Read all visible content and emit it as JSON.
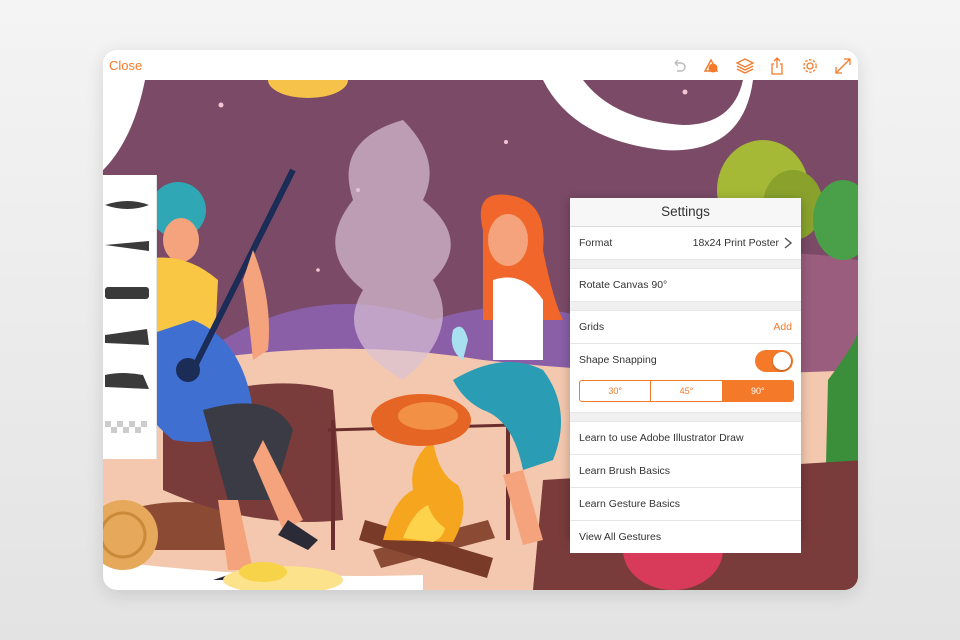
{
  "toolbar": {
    "close_label": "Close",
    "icons": [
      "undo-icon",
      "shapes-icon",
      "layers-icon",
      "share-icon",
      "gear-icon",
      "expand-icon"
    ],
    "accent_color": "#f47a2a"
  },
  "settings": {
    "title": "Settings",
    "format_label": "Format",
    "format_value": "18x24 Print Poster",
    "rotate_label": "Rotate Canvas 90°",
    "grids_label": "Grids",
    "grids_action": "Add",
    "shape_snapping_label": "Shape Snapping",
    "shape_snapping_on": true,
    "angles": [
      "30°",
      "45°",
      "90°"
    ],
    "selected_angle": "90°",
    "learn_draw": "Learn to use Adobe Illustrator Draw",
    "learn_brush": "Learn Brush Basics",
    "learn_gesture": "Learn Gesture Basics",
    "view_gestures": "View All Gestures"
  }
}
